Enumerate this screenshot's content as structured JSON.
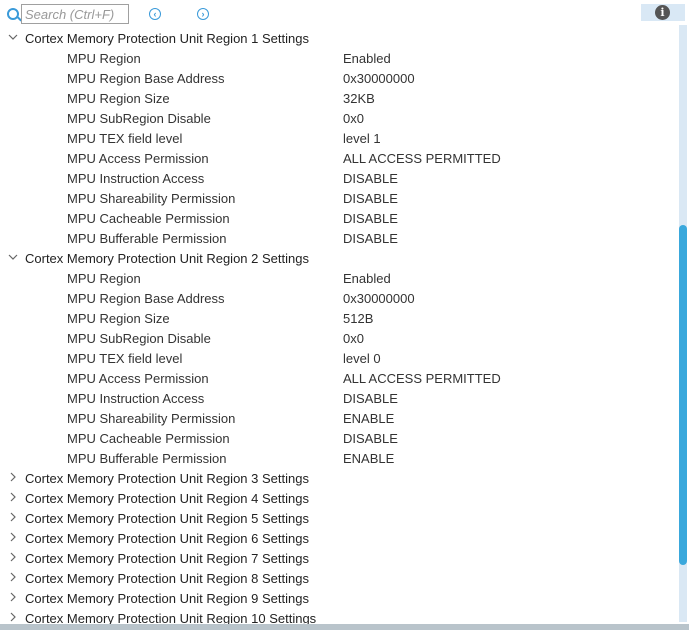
{
  "toolbar": {
    "search_placeholder": "Search (Ctrl+F)",
    "prev_icon": "‹",
    "next_icon": "›",
    "info_icon": "i"
  },
  "regions": [
    {
      "title": "Cortex Memory Protection Unit Region 1 Settings",
      "expanded": true,
      "props": [
        [
          "MPU Region",
          "Enabled"
        ],
        [
          "MPU Region Base Address",
          "0x30000000"
        ],
        [
          "MPU Region Size",
          "32KB"
        ],
        [
          "MPU SubRegion Disable",
          "0x0"
        ],
        [
          "MPU TEX field level",
          "level 1"
        ],
        [
          "MPU Access Permission",
          "ALL ACCESS PERMITTED"
        ],
        [
          "MPU Instruction Access",
          "DISABLE"
        ],
        [
          "MPU Shareability Permission",
          "DISABLE"
        ],
        [
          "MPU Cacheable Permission",
          "DISABLE"
        ],
        [
          "MPU Bufferable  Permission",
          "DISABLE"
        ]
      ]
    },
    {
      "title": "Cortex Memory Protection Unit Region 2 Settings",
      "expanded": true,
      "props": [
        [
          "MPU Region",
          "Enabled"
        ],
        [
          "MPU Region Base Address",
          "0x30000000"
        ],
        [
          "MPU Region Size",
          "512B"
        ],
        [
          "MPU SubRegion Disable",
          "0x0"
        ],
        [
          "MPU TEX field level",
          "level 0"
        ],
        [
          "MPU Access Permission",
          "ALL ACCESS PERMITTED"
        ],
        [
          "MPU Instruction Access",
          "DISABLE"
        ],
        [
          "MPU Shareability Permission",
          "ENABLE"
        ],
        [
          "MPU Cacheable Permission",
          "DISABLE"
        ],
        [
          "MPU Bufferable  Permission",
          "ENABLE"
        ]
      ]
    },
    {
      "title": "Cortex Memory Protection Unit Region 3 Settings",
      "expanded": false,
      "props": []
    },
    {
      "title": "Cortex Memory Protection Unit Region 4 Settings",
      "expanded": false,
      "props": []
    },
    {
      "title": "Cortex Memory Protection Unit Region 5 Settings",
      "expanded": false,
      "props": []
    },
    {
      "title": "Cortex Memory Protection Unit Region 6 Settings",
      "expanded": false,
      "props": []
    },
    {
      "title": "Cortex Memory Protection Unit Region 7 Settings",
      "expanded": false,
      "props": []
    },
    {
      "title": "Cortex Memory Protection Unit Region 8 Settings",
      "expanded": false,
      "props": []
    },
    {
      "title": "Cortex Memory Protection Unit Region 9 Settings",
      "expanded": false,
      "props": []
    },
    {
      "title": "Cortex Memory Protection Unit Region 10 Settings",
      "expanded": false,
      "props": []
    }
  ]
}
